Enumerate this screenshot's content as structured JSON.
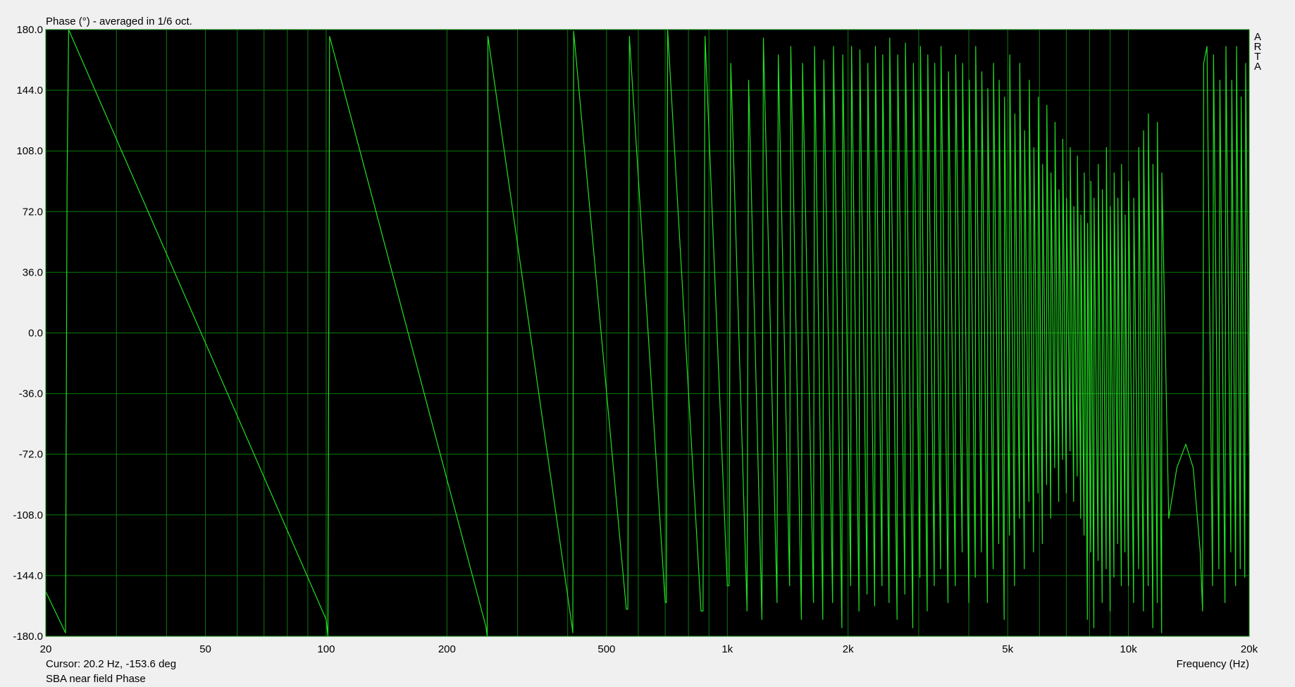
{
  "chart_data": {
    "type": "line",
    "title": "Phase (°) - averaged in 1/6 oct.",
    "xlabel": "Frequency (Hz)",
    "ylabel": "",
    "x_scale": "log",
    "xlim": [
      20,
      20000
    ],
    "ylim": [
      -180,
      180
    ],
    "y_ticks": [
      "180.0",
      "144.0",
      "108.0",
      "72.0",
      "36.0",
      "0.0",
      "-36.0",
      "-72.0",
      "-108.0",
      "-144.0",
      "-180.0"
    ],
    "x_ticks": [
      {
        "v": 20,
        "label": "20"
      },
      {
        "v": 50,
        "label": "50"
      },
      {
        "v": 100,
        "label": "100"
      },
      {
        "v": 200,
        "label": "200"
      },
      {
        "v": 500,
        "label": "500"
      },
      {
        "v": 1000,
        "label": "1k"
      },
      {
        "v": 2000,
        "label": "2k"
      },
      {
        "v": 5000,
        "label": "5k"
      },
      {
        "v": 10000,
        "label": "10k"
      },
      {
        "v": 20000,
        "label": "20k"
      }
    ],
    "grid": true,
    "watermark": "ARTA",
    "cursor_text": "Cursor: 20.2 Hz, -153.6 deg",
    "series": [
      {
        "name": "SBA near field Phase",
        "color": "#22e022",
        "points": [
          [
            20,
            -153.6
          ],
          [
            22.4,
            -178
          ],
          [
            22.6,
            90
          ],
          [
            22.8,
            180
          ],
          [
            100,
            -170
          ],
          [
            101,
            -180
          ],
          [
            102,
            176
          ],
          [
            250,
            -174
          ],
          [
            252,
            -180
          ],
          [
            253,
            176
          ],
          [
            410,
            -174
          ],
          [
            412,
            -178
          ],
          [
            414,
            179
          ],
          [
            560,
            -164
          ],
          [
            565,
            -164
          ],
          [
            570,
            176
          ],
          [
            700,
            -160
          ],
          [
            705,
            -160
          ],
          [
            710,
            180
          ],
          [
            860,
            -165
          ],
          [
            870,
            -165
          ],
          [
            880,
            176
          ],
          [
            1000,
            -150
          ],
          [
            1010,
            -150
          ],
          [
            1020,
            160
          ],
          [
            1120,
            -165
          ],
          [
            1130,
            150
          ],
          [
            1220,
            -170
          ],
          [
            1230,
            175
          ],
          [
            1330,
            -160
          ],
          [
            1340,
            165
          ],
          [
            1430,
            -150
          ],
          [
            1440,
            170
          ],
          [
            1530,
            -170
          ],
          [
            1540,
            160
          ],
          [
            1640,
            -160
          ],
          [
            1650,
            170
          ],
          [
            1730,
            -170
          ],
          [
            1740,
            162
          ],
          [
            1830,
            -160
          ],
          [
            1840,
            170
          ],
          [
            1930,
            -175
          ],
          [
            1940,
            165
          ],
          [
            2030,
            -150
          ],
          [
            2040,
            170
          ],
          [
            2130,
            -165
          ],
          [
            2140,
            168
          ],
          [
            2230,
            -155
          ],
          [
            2240,
            160
          ],
          [
            2330,
            -162
          ],
          [
            2340,
            170
          ],
          [
            2430,
            -150
          ],
          [
            2440,
            165
          ],
          [
            2530,
            -160
          ],
          [
            2540,
            175
          ],
          [
            2650,
            -170
          ],
          [
            2660,
            165
          ],
          [
            2770,
            -155
          ],
          [
            2780,
            172
          ],
          [
            2900,
            -175
          ],
          [
            2910,
            160
          ],
          [
            3020,
            -145
          ],
          [
            3030,
            170
          ],
          [
            3150,
            -165
          ],
          [
            3160,
            165
          ],
          [
            3280,
            -150
          ],
          [
            3290,
            160
          ],
          [
            3400,
            -140
          ],
          [
            3410,
            170
          ],
          [
            3550,
            -160
          ],
          [
            3560,
            155
          ],
          [
            3700,
            -150
          ],
          [
            3710,
            165
          ],
          [
            3850,
            -130
          ],
          [
            3860,
            160
          ],
          [
            4000,
            -160
          ],
          [
            4010,
            150
          ],
          [
            4150,
            -145
          ],
          [
            4160,
            170
          ],
          [
            4300,
            -130
          ],
          [
            4310,
            155
          ],
          [
            4450,
            -160
          ],
          [
            4460,
            145
          ],
          [
            4600,
            -140
          ],
          [
            4610,
            160
          ],
          [
            4750,
            -125
          ],
          [
            4760,
            150
          ],
          [
            4900,
            -170
          ],
          [
            4910,
            140
          ],
          [
            5050,
            -120
          ],
          [
            5060,
            165
          ],
          [
            5200,
            -150
          ],
          [
            5210,
            130
          ],
          [
            5350,
            -110
          ],
          [
            5360,
            160
          ],
          [
            5500,
            -140
          ],
          [
            5510,
            120
          ],
          [
            5650,
            -100
          ],
          [
            5660,
            150
          ],
          [
            5800,
            -130
          ],
          [
            5810,
            110
          ],
          [
            5950,
            -95
          ],
          [
            5960,
            140
          ],
          [
            6100,
            -125
          ],
          [
            6110,
            100
          ],
          [
            6250,
            -90
          ],
          [
            6260,
            135
          ],
          [
            6400,
            -110
          ],
          [
            6410,
            95
          ],
          [
            6550,
            -80
          ],
          [
            6560,
            125
          ],
          [
            6700,
            -100
          ],
          [
            6710,
            85
          ],
          [
            6850,
            -75
          ],
          [
            6860,
            115
          ],
          [
            7000,
            -95
          ],
          [
            7010,
            80
          ],
          [
            7150,
            -70
          ],
          [
            7160,
            110
          ],
          [
            7300,
            -100
          ],
          [
            7310,
            75
          ],
          [
            7450,
            -85
          ],
          [
            7460,
            105
          ],
          [
            7600,
            -110
          ],
          [
            7610,
            70
          ],
          [
            7750,
            -120
          ],
          [
            7760,
            95
          ],
          [
            7900,
            -170
          ],
          [
            7910,
            65
          ],
          [
            8050,
            -130
          ],
          [
            8060,
            90
          ],
          [
            8200,
            -175
          ],
          [
            8210,
            80
          ],
          [
            8400,
            -135
          ],
          [
            8410,
            100
          ],
          [
            8600,
            -160
          ],
          [
            8610,
            85
          ],
          [
            8800,
            -140
          ],
          [
            8810,
            110
          ],
          [
            9000,
            -165
          ],
          [
            9010,
            75
          ],
          [
            9200,
            -145
          ],
          [
            9210,
            95
          ],
          [
            9400,
            -125
          ],
          [
            9410,
            80
          ],
          [
            9600,
            -150
          ],
          [
            9610,
            100
          ],
          [
            9800,
            -130
          ],
          [
            9810,
            70
          ],
          [
            10000,
            -150
          ],
          [
            10010,
            90
          ],
          [
            10300,
            -160
          ],
          [
            10310,
            80
          ],
          [
            10600,
            -140
          ],
          [
            10610,
            110
          ],
          [
            10900,
            -165
          ],
          [
            10910,
            120
          ],
          [
            11200,
            -150
          ],
          [
            11210,
            130
          ],
          [
            11500,
            -175
          ],
          [
            11510,
            100
          ],
          [
            11800,
            -160
          ],
          [
            11810,
            125
          ],
          [
            12100,
            -178
          ],
          [
            12110,
            95
          ],
          [
            12600,
            -110
          ],
          [
            13200,
            -80
          ],
          [
            13900,
            -66
          ],
          [
            14500,
            -80
          ],
          [
            15100,
            -130
          ],
          [
            15300,
            -165
          ],
          [
            15400,
            160
          ],
          [
            15700,
            170
          ],
          [
            16200,
            -150
          ],
          [
            16300,
            165
          ],
          [
            16800,
            -140
          ],
          [
            16900,
            150
          ],
          [
            17400,
            -160
          ],
          [
            17500,
            170
          ],
          [
            18000,
            -130
          ],
          [
            18100,
            150
          ],
          [
            18500,
            -150
          ],
          [
            18600,
            170
          ],
          [
            19000,
            -140
          ],
          [
            19100,
            140
          ],
          [
            19500,
            -145
          ],
          [
            19600,
            160
          ],
          [
            20000,
            -75
          ]
        ]
      }
    ]
  },
  "legend_text": "SBA near field Phase"
}
